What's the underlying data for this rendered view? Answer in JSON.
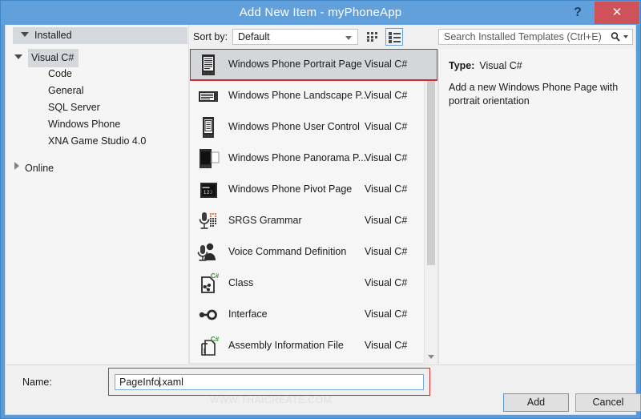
{
  "window": {
    "title": "Add New Item - myPhoneApp",
    "help_label": "?",
    "close_label": "✕"
  },
  "sidebar": {
    "header": "Installed",
    "nodes": [
      {
        "label": "Visual C#",
        "expanded": true,
        "selected": true
      },
      {
        "label": "Code",
        "child": true
      },
      {
        "label": "General",
        "child": true
      },
      {
        "label": "SQL Server",
        "child": true
      },
      {
        "label": "Windows Phone",
        "child": true
      },
      {
        "label": "XNA Game Studio 4.0",
        "child": true
      },
      {
        "label": "Online",
        "expanded": false,
        "selected": false
      }
    ]
  },
  "toolbar": {
    "sort_label": "Sort by:",
    "sort_value": "Default",
    "view_small_icon": "small-icons-view-icon",
    "view_large_icon": "details-list-view-icon",
    "search_placeholder": "Search Installed Templates (Ctrl+E)",
    "search_icon": "search-icon"
  },
  "templates": [
    {
      "name": "Windows Phone Portrait Page",
      "lang": "Visual C#",
      "icon": "phone-portrait-page-icon",
      "selected": true
    },
    {
      "name": "Windows Phone Landscape P...",
      "lang": "Visual C#",
      "icon": "phone-landscape-page-icon",
      "selected": false
    },
    {
      "name": "Windows Phone User Control",
      "lang": "Visual C#",
      "icon": "phone-user-control-icon",
      "selected": false
    },
    {
      "name": "Windows Phone Panorama P...",
      "lang": "Visual C#",
      "icon": "phone-panorama-page-icon",
      "selected": false
    },
    {
      "name": "Windows Phone Pivot Page",
      "lang": "Visual C#",
      "icon": "phone-pivot-page-icon",
      "selected": false
    },
    {
      "name": "SRGS Grammar",
      "lang": "Visual C#",
      "icon": "microphone-grammar-icon",
      "selected": false
    },
    {
      "name": "Voice Command Definition",
      "lang": "Visual C#",
      "icon": "voice-command-icon",
      "selected": false
    },
    {
      "name": "Class",
      "lang": "Visual C#",
      "icon": "csharp-class-icon",
      "selected": false
    },
    {
      "name": "Interface",
      "lang": "Visual C#",
      "icon": "interface-icon",
      "selected": false
    },
    {
      "name": "Assembly Information File",
      "lang": "Visual C#",
      "icon": "assembly-info-file-icon",
      "selected": false
    }
  ],
  "details": {
    "type_label": "Type:",
    "type_value": "Visual C#",
    "description": "Add a new Windows Phone Page with portrait orientation"
  },
  "bottom": {
    "name_label": "Name:",
    "name_value_before_caret": "PageInfo",
    "name_value_after_caret": ".xaml",
    "add_label": "Add",
    "cancel_label": "Cancel",
    "watermark": "WWW.THAICREATE.COM"
  },
  "colors": {
    "titlebar": "#62a0dc",
    "close_button": "#cf5159",
    "selection_outline": "#d22b2b",
    "selected_row": "#d4d6da",
    "accent_border": "#5b9bd5"
  }
}
